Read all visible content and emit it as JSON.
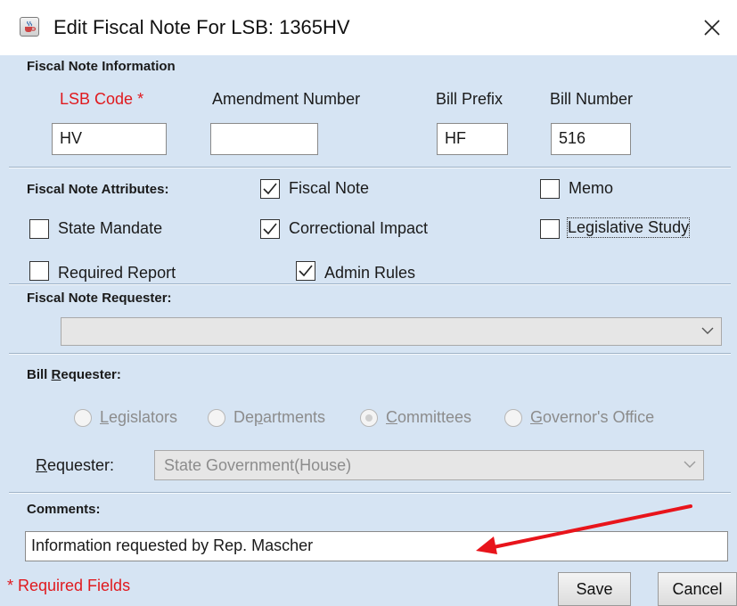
{
  "window": {
    "title": "Edit Fiscal Note For LSB: 1365HV",
    "app_icon": "java-cup-icon",
    "close_icon": "close-x-icon"
  },
  "fiscal_note_info": {
    "heading": "Fiscal Note Information",
    "lsb_code_label": "LSB Code",
    "required_marker": "*",
    "amendment_label": "Amendment Number",
    "bill_prefix_label": "Bill Prefix",
    "bill_number_label": "Bill Number",
    "lsb_code_value": "HV",
    "amendment_value": "",
    "bill_prefix_value": "HF",
    "bill_number_value": "516"
  },
  "attributes": {
    "heading": "Fiscal Note Attributes:",
    "fiscal_note": {
      "label": "Fiscal Note",
      "checked": true
    },
    "memo": {
      "label": "Memo",
      "checked": false
    },
    "state_mandate": {
      "label": "State Mandate",
      "checked": false
    },
    "correctional_impact": {
      "label": "Correctional Impact",
      "checked": true
    },
    "legislative_study": {
      "label": "Legislative Study",
      "checked": false
    },
    "required_report": {
      "label": "Required Report",
      "checked": false
    },
    "admin_rules": {
      "label": "Admin Rules",
      "checked": true
    }
  },
  "requester_section": {
    "heading": "Fiscal Note Requester:",
    "selected": ""
  },
  "bill_requester": {
    "heading_pre": "Bill ",
    "heading_mnemonic": "R",
    "heading_post": "equester:",
    "options": [
      {
        "mnemonic": "L",
        "rest": "egislators",
        "selected": false
      },
      {
        "pre": "De",
        "mnemonic": "p",
        "rest": "artments",
        "selected": false
      },
      {
        "mnemonic": "C",
        "rest": "ommittees",
        "selected": true
      },
      {
        "mnemonic": "G",
        "rest": "overnor's Office",
        "selected": false
      }
    ],
    "requester_label_mnemonic": "R",
    "requester_label_rest": "equester:",
    "requester_value": "State Government(House)"
  },
  "comments": {
    "heading": "Comments:",
    "value": "Information requested by Rep. Mascher"
  },
  "footer": {
    "required_note": "* Required Fields",
    "save_label": "Save",
    "cancel_label": "Cancel"
  },
  "colors": {
    "panel": "#d6e4f3",
    "required": "#e0191e",
    "annotation_arrow": "#e8141b"
  }
}
